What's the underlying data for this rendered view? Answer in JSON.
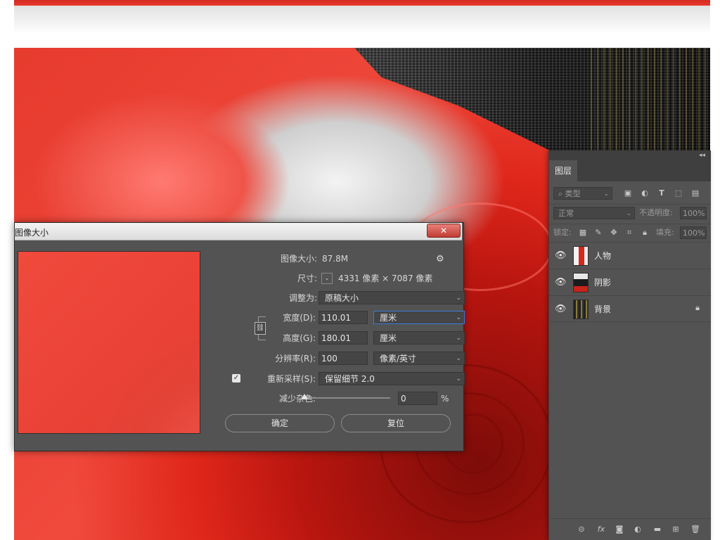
{
  "layers_panel": {
    "collapse_icon": "double-chevron-left",
    "tab_label": "图层",
    "search_placeholder": "类型",
    "blend_mode": "正常",
    "opacity_label": "不透明度:",
    "opacity_value": "100%",
    "lock_label": "锁定:",
    "fill_label": "填充:",
    "fill_value": "100%",
    "layers": [
      {
        "name": "人物",
        "visible": true,
        "locked": false
      },
      {
        "name": "阴影",
        "visible": true,
        "locked": false
      },
      {
        "name": "背景",
        "visible": true,
        "locked": true
      }
    ]
  },
  "dialog": {
    "title": "图像大小",
    "close_label": "✕",
    "image_size_label": "图像大小:",
    "image_size_value": "87.8M",
    "dimensions_label": "尺寸:",
    "dimensions_value": "4331 像素  ×  7087 像素",
    "fit_to_label": "调整为:",
    "fit_to_value": "原稿大小",
    "width_label": "宽度(D):",
    "width_value": "110.01",
    "width_unit": "厘米",
    "height_label": "高度(G):",
    "height_value": "180.01",
    "height_unit": "厘米",
    "resolution_label": "分辨率(R):",
    "resolution_value": "100",
    "resolution_unit": "像素/英寸",
    "resample_label": "重新采样(S):",
    "resample_checked": true,
    "resample_value": "保留细节 2.0",
    "noise_label": "减少杂色:",
    "noise_value": "0",
    "noise_unit": "%",
    "noise_level": 0,
    "ok_label": "确定",
    "reset_label": "复位"
  },
  "colors": {
    "panel_bg": "#535353",
    "artwork_red": "#e63b2e",
    "focus_blue": "#3d7ad6"
  }
}
